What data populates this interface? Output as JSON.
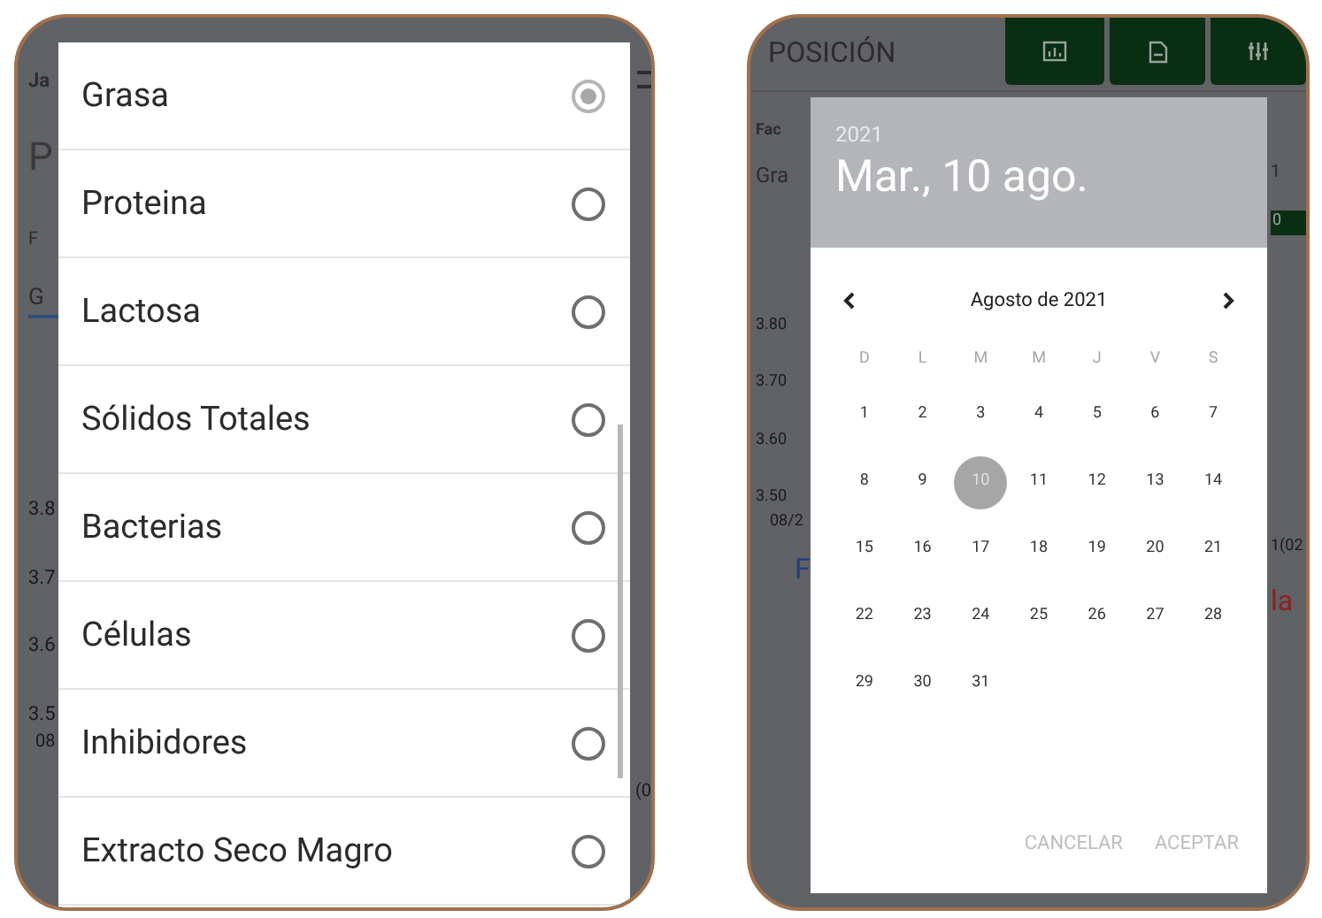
{
  "left_screen": {
    "backdrop": {
      "header_fragments": [
        "Ja",
        "P",
        "F",
        "G"
      ],
      "axis_labels": [
        "3.8",
        "3.7",
        "3.6",
        "3.5"
      ],
      "x_label": "08",
      "right_fragment": "(0"
    },
    "options": [
      {
        "label": "Grasa",
        "selected": true
      },
      {
        "label": "Proteina",
        "selected": false
      },
      {
        "label": "Lactosa",
        "selected": false
      },
      {
        "label": "Sólidos Totales",
        "selected": false
      },
      {
        "label": "Bacterias",
        "selected": false
      },
      {
        "label": "Células",
        "selected": false
      },
      {
        "label": "Inhibidores",
        "selected": false
      },
      {
        "label": "Extracto Seco Magro",
        "selected": false
      }
    ]
  },
  "right_screen": {
    "title": "POSICIÓN",
    "toolbar": [
      {
        "kind": "chart"
      },
      {
        "kind": "document"
      },
      {
        "kind": "sliders"
      }
    ],
    "backdrop": {
      "field_fragments": [
        "Fac",
        "Gra"
      ],
      "axis_labels": [
        "3.80",
        "3.70",
        "3.60",
        "3.50"
      ],
      "x_label": "08/2",
      "right_fragments": [
        "1",
        "0",
        "1(02",
        "la"
      ],
      "link_fragment": "F"
    },
    "date_picker": {
      "year": "2021",
      "date": "Mar., 10 ago.",
      "month": "Agosto de 2021",
      "weekdays": [
        "D",
        "L",
        "M",
        "M",
        "J",
        "V",
        "S"
      ],
      "days": [
        {
          "label": "1",
          "selected": false
        },
        {
          "label": "2",
          "selected": false
        },
        {
          "label": "3",
          "selected": false
        },
        {
          "label": "4",
          "selected": false
        },
        {
          "label": "5",
          "selected": false
        },
        {
          "label": "6",
          "selected": false
        },
        {
          "label": "7",
          "selected": false
        },
        {
          "label": "8",
          "selected": false
        },
        {
          "label": "9",
          "selected": false
        },
        {
          "label": "10",
          "selected": true
        },
        {
          "label": "11",
          "selected": false
        },
        {
          "label": "12",
          "selected": false
        },
        {
          "label": "13",
          "selected": false
        },
        {
          "label": "14",
          "selected": false
        },
        {
          "label": "15",
          "selected": false
        },
        {
          "label": "16",
          "selected": false
        },
        {
          "label": "17",
          "selected": false
        },
        {
          "label": "18",
          "selected": false
        },
        {
          "label": "19",
          "selected": false
        },
        {
          "label": "20",
          "selected": false
        },
        {
          "label": "21",
          "selected": false
        },
        {
          "label": "22",
          "selected": false
        },
        {
          "label": "23",
          "selected": false
        },
        {
          "label": "24",
          "selected": false
        },
        {
          "label": "25",
          "selected": false
        },
        {
          "label": "26",
          "selected": false
        },
        {
          "label": "27",
          "selected": false
        },
        {
          "label": "28",
          "selected": false
        },
        {
          "label": "29",
          "selected": false
        },
        {
          "label": "30",
          "selected": false
        },
        {
          "label": "31",
          "selected": false
        }
      ],
      "actions": [
        "CANCELAR",
        "ACEPTAR"
      ]
    }
  }
}
